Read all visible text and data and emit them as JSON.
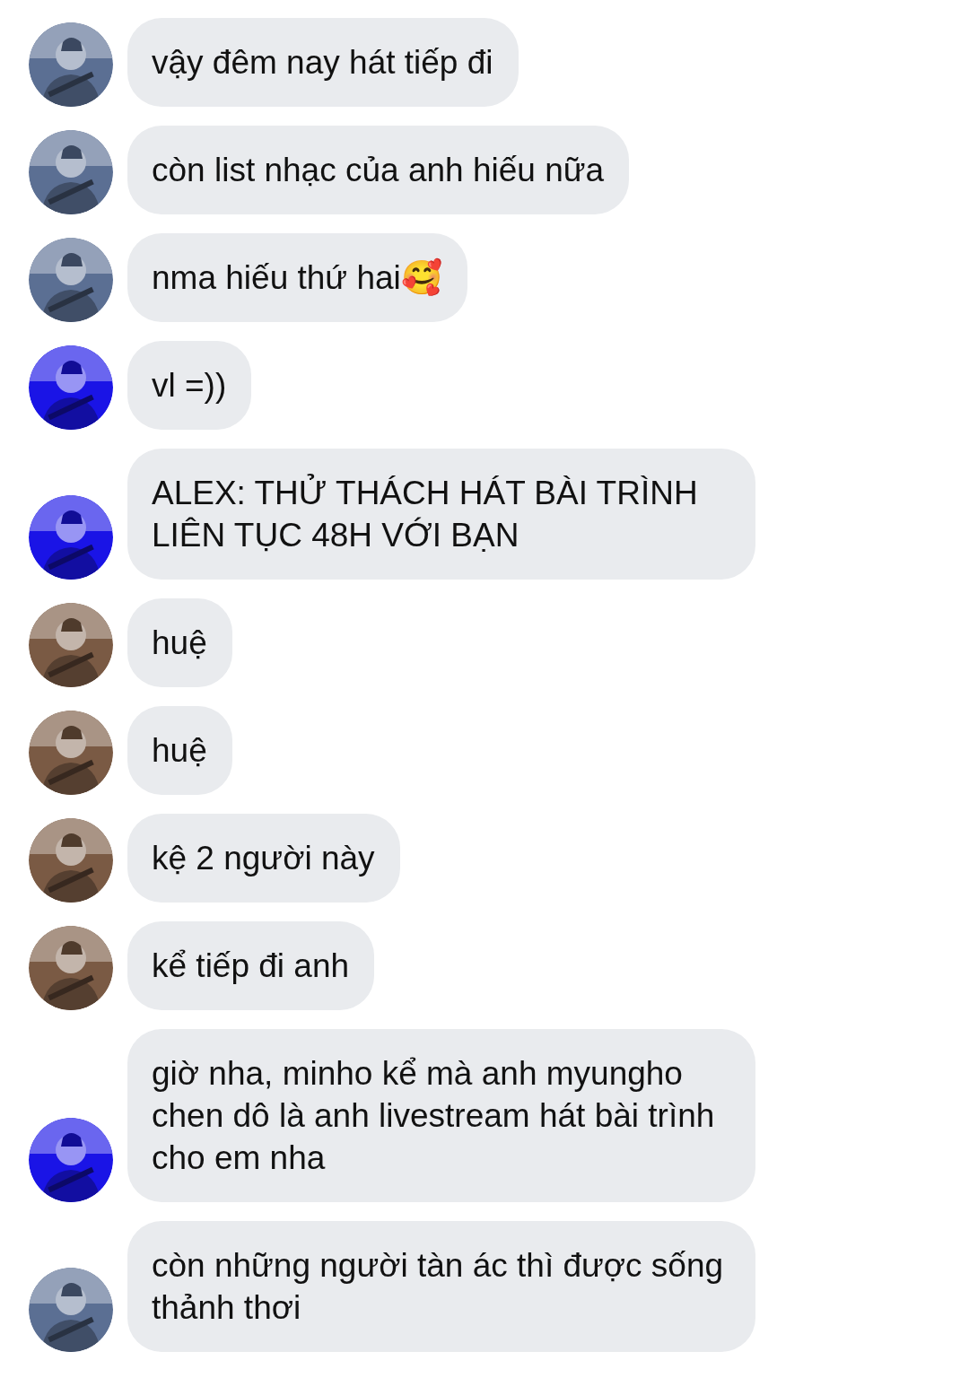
{
  "messages": [
    {
      "color": "#5b6f93",
      "text": "vậy đêm nay hát tiếp đi"
    },
    {
      "color": "#5b6f93",
      "text": "còn list nhạc của anh hiếu nữa"
    },
    {
      "color": "#5b6f93",
      "text": "nma hiếu thứ hai🥰"
    },
    {
      "color": "#1a14e6",
      "text": "vl =))"
    },
    {
      "color": "#1a14e6",
      "text": "ALEX: THỬ THÁCH HÁT BÀI TRÌNH LIÊN TỤC 48H VỚI BẠN"
    },
    {
      "color": "#7a5a44",
      "text": "huệ"
    },
    {
      "color": "#7a5a44",
      "text": "huệ"
    },
    {
      "color": "#7a5a44",
      "text": "kệ 2 người này"
    },
    {
      "color": "#7a5a44",
      "text": "kể tiếp đi anh"
    },
    {
      "color": "#1a14e6",
      "text": "giờ nha, minho kể mà anh myungho chen dô là anh livestream hát bài trình cho em nha"
    },
    {
      "color": "#5b6f93",
      "text": "còn những người tàn ác thì được sống thảnh thơi"
    }
  ]
}
